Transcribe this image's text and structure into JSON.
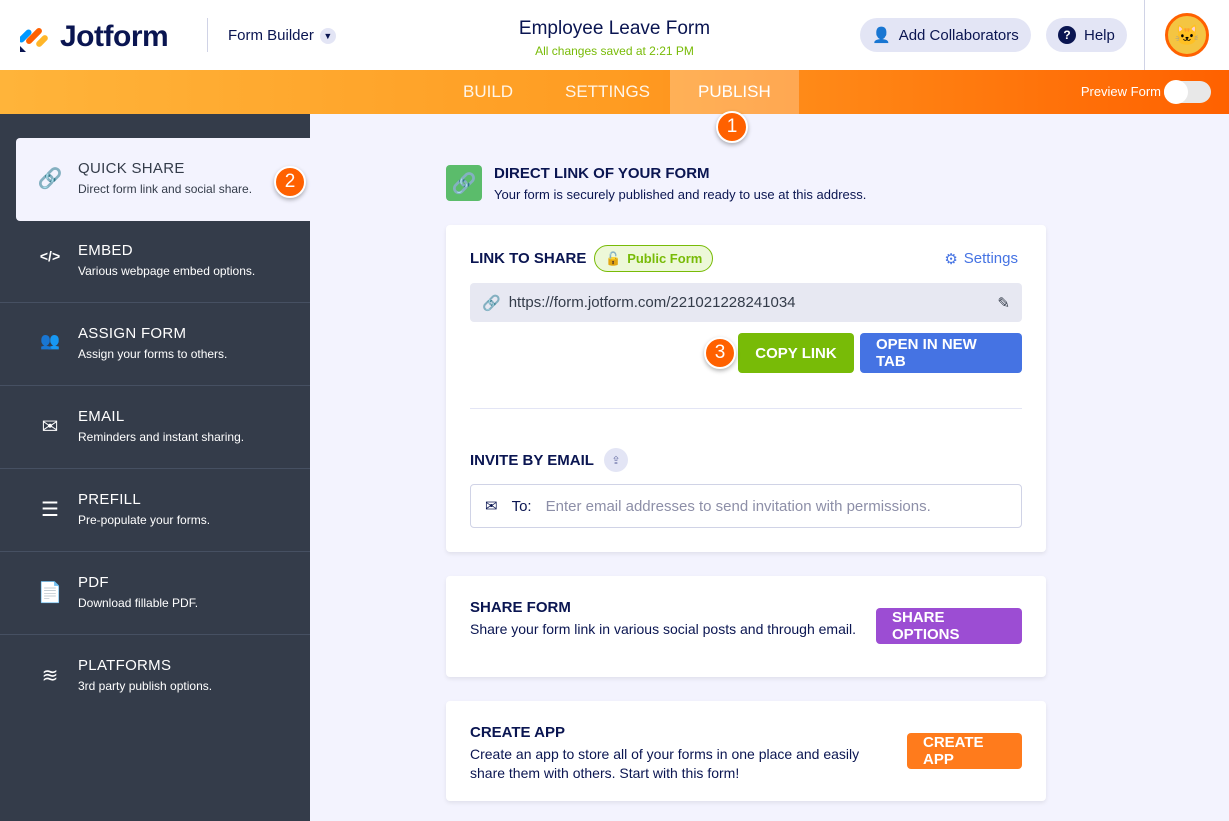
{
  "header": {
    "brand": "Jotform",
    "app_switcher": "Form Builder",
    "title": "Employee Leave Form",
    "saved_status": "All changes saved at 2:21 PM",
    "collaborators": "Add Collaborators",
    "help": "Help"
  },
  "nav": {
    "tabs": [
      "BUILD",
      "SETTINGS",
      "PUBLISH"
    ],
    "active": "PUBLISH",
    "preview_label": "Preview Form",
    "preview_on": false
  },
  "callouts": [
    "1",
    "2",
    "3"
  ],
  "sidebar": {
    "items": [
      {
        "label": "QUICK SHARE",
        "sub": "Direct form link and social share.",
        "icon": "link-icon"
      },
      {
        "label": "EMBED",
        "sub": "Various webpage embed options.",
        "icon": "code-icon"
      },
      {
        "label": "ASSIGN FORM",
        "sub": "Assign your forms to others.",
        "icon": "users-icon"
      },
      {
        "label": "EMAIL",
        "sub": "Reminders and instant sharing.",
        "icon": "envelope-icon"
      },
      {
        "label": "PREFILL",
        "sub": "Pre-populate your forms.",
        "icon": "prefill-icon"
      },
      {
        "label": "PDF",
        "sub": "Download fillable PDF.",
        "icon": "pdf-icon"
      },
      {
        "label": "PLATFORMS",
        "sub": "3rd party publish options.",
        "icon": "layers-icon"
      }
    ]
  },
  "direct": {
    "title": "DIRECT LINK OF YOUR FORM",
    "subtitle": "Your form is securely published and ready to use at this address."
  },
  "share": {
    "title": "LINK TO SHARE",
    "badge": "Public Form",
    "settings": "Settings",
    "url": "https://form.jotform.com/221021228241034",
    "copy": "COPY LINK",
    "open": "OPEN IN NEW TAB",
    "invite_title": "INVITE BY EMAIL",
    "to_label": "To:",
    "email_placeholder": "Enter email addresses to send invitation with permissions."
  },
  "share_form": {
    "title": "SHARE FORM",
    "desc": "Share your form link in various social posts and through email.",
    "button": "SHARE OPTIONS"
  },
  "create_app": {
    "title": "CREATE APP",
    "desc": "Create an app to store all of your forms in one place and easily share them with others. Start with this form!",
    "button": "CREATE APP"
  },
  "colors": {
    "orange": "#ff6100",
    "green": "#78bb07",
    "blue": "#4573e3",
    "purple": "#9c4dd3",
    "sidebar": "#343c4a"
  }
}
